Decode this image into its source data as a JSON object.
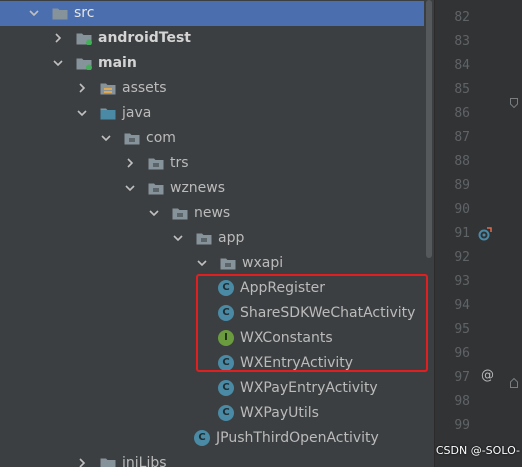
{
  "tree": {
    "items": [
      {
        "label": "src",
        "depth": 0,
        "expanded": true,
        "icon": "folder-icon",
        "selected": true
      },
      {
        "label": "androidTest",
        "depth": 1,
        "expanded": false,
        "icon": "test-folder-icon",
        "bold": true
      },
      {
        "label": "main",
        "depth": 1,
        "expanded": true,
        "icon": "test-folder-icon",
        "bold": true
      },
      {
        "label": "assets",
        "depth": 2,
        "expanded": false,
        "icon": "resource-folder-icon"
      },
      {
        "label": "java",
        "depth": 2,
        "expanded": true,
        "icon": "source-folder-icon"
      },
      {
        "label": "com",
        "depth": 3,
        "expanded": true,
        "icon": "package-icon"
      },
      {
        "label": "trs",
        "depth": 4,
        "expanded": false,
        "icon": "package-icon"
      },
      {
        "label": "wznews",
        "depth": 4,
        "expanded": true,
        "icon": "package-icon"
      },
      {
        "label": "news",
        "depth": 5,
        "expanded": true,
        "icon": "package-icon"
      },
      {
        "label": "app",
        "depth": 6,
        "expanded": true,
        "icon": "package-icon"
      },
      {
        "label": "wxapi",
        "depth": 7,
        "expanded": true,
        "icon": "package-icon"
      },
      {
        "label": "AppRegister",
        "depth": 8,
        "icon": "class-icon",
        "kind": "C"
      },
      {
        "label": "ShareSDKWeChatActivity",
        "depth": 8,
        "icon": "class-icon",
        "kind": "C"
      },
      {
        "label": "WXConstants",
        "depth": 8,
        "icon": "interface-icon",
        "kind": "I"
      },
      {
        "label": "WXEntryActivity",
        "depth": 8,
        "icon": "class-icon",
        "kind": "C"
      },
      {
        "label": "WXPayEntryActivity",
        "depth": 8,
        "icon": "class-icon",
        "kind": "C"
      },
      {
        "label": "WXPayUtils",
        "depth": 8,
        "icon": "class-icon",
        "kind": "C"
      },
      {
        "label": "JPushThirdOpenActivity",
        "depth": 7,
        "icon": "class-icon",
        "kind": "C"
      },
      {
        "label": "jniLibs",
        "depth": 2,
        "expanded": false,
        "icon": "folder-icon"
      }
    ]
  },
  "gutter": {
    "line_numbers": [
      "82",
      "83",
      "84",
      "85",
      "86",
      "87",
      "88",
      "89",
      "90",
      "91",
      "92",
      "93",
      "94",
      "95",
      "96",
      "97",
      "98",
      "99"
    ],
    "marker_97": "@"
  },
  "watermark": "CSDN @-SOLO-",
  "colors": {
    "selection": "#4b6eaf",
    "highlight_box": "#e02020",
    "class_icon": "#4a8aa4",
    "interface_icon": "#6a9b3f"
  }
}
